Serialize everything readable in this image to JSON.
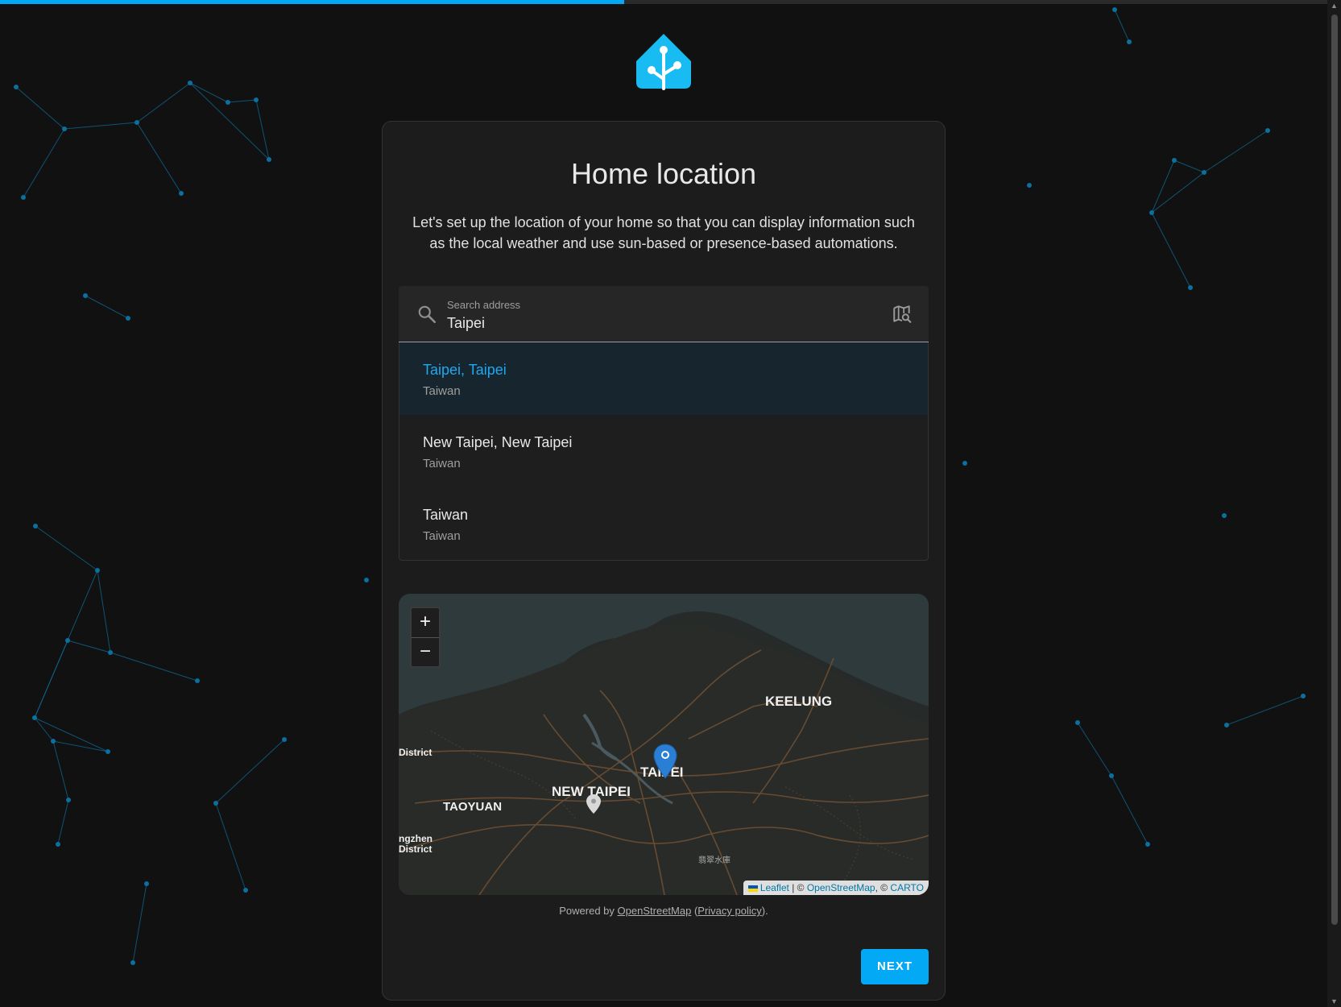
{
  "progress": {
    "fraction": 0.47,
    "color": "#03a9f4"
  },
  "logo": {
    "icon": "home-assistant-logo-icon",
    "color": "#18bcf2"
  },
  "card": {
    "title": "Home location",
    "description": "Let's set up the location of your home so that you can display information such as the local weather and use sun-based or presence-based automations."
  },
  "search": {
    "label": "Search address",
    "value": "Taipei",
    "icon": "search-icon",
    "map_icon": "map-search-icon"
  },
  "suggestions": [
    {
      "name": "Taipei, Taipei",
      "country": "Taiwan",
      "selected": true
    },
    {
      "name": "New Taipei, New Taipei",
      "country": "Taiwan",
      "selected": false
    },
    {
      "name": "Taiwan",
      "country": "Taiwan",
      "selected": false
    }
  ],
  "map": {
    "zoom_in": "+",
    "zoom_out": "−",
    "labels": {
      "keelung": "KEELUNG",
      "taipei": "TAIPEI",
      "new_taipei": "NEW TAIPEI",
      "taoyuan": "TAOYUAN",
      "district": "District",
      "zhongzheng_1": "ngzhen",
      "zhongzheng_2": "District",
      "reservoir": "翡翠水庫"
    },
    "attribution": {
      "leaflet": "Leaflet",
      "sep1": "| ©",
      "osm": "OpenStreetMap",
      "sep2": ", ©",
      "carto": "CARTO"
    }
  },
  "powered": {
    "prefix": "Powered by",
    "osm": "OpenStreetMap",
    "open": "(",
    "privacy": "Privacy policy",
    "close": ")."
  },
  "next_button": {
    "label": "NEXT"
  }
}
